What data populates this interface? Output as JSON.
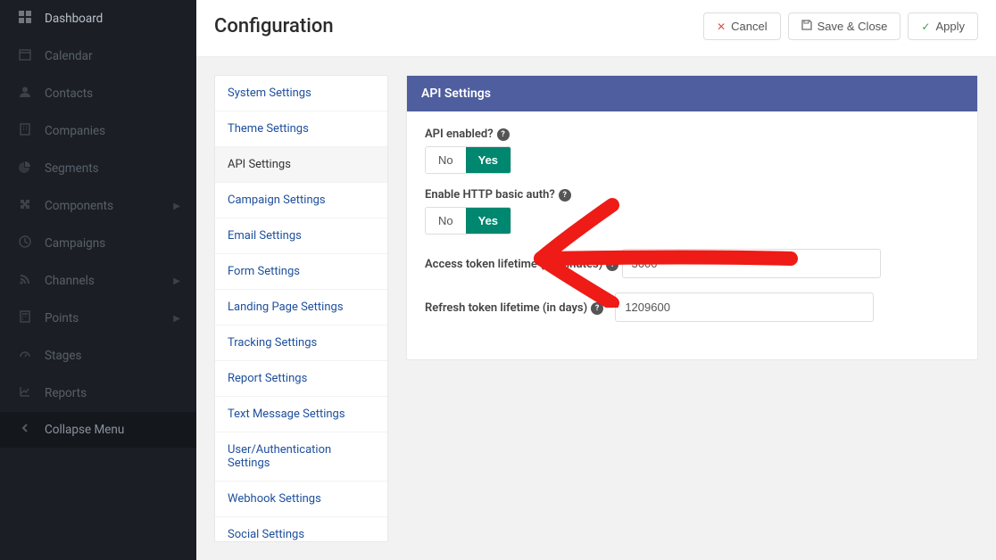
{
  "header": {
    "title": "Configuration",
    "buttons": {
      "cancel": "Cancel",
      "save_close": "Save & Close",
      "apply": "Apply"
    }
  },
  "sidebar": {
    "items": [
      {
        "icon": "⊞",
        "label": "Dashboard",
        "chev": false
      },
      {
        "icon": "🗓",
        "label": "Calendar",
        "chev": false
      },
      {
        "icon": "👤",
        "label": "Contacts",
        "chev": false
      },
      {
        "icon": "🏢",
        "label": "Companies",
        "chev": false
      },
      {
        "icon": "◔",
        "label": "Segments",
        "chev": false
      },
      {
        "icon": "⊕",
        "label": "Components",
        "chev": true
      },
      {
        "icon": "◷",
        "label": "Campaigns",
        "chev": false
      },
      {
        "icon": "≋",
        "label": "Channels",
        "chev": true
      },
      {
        "icon": "▤",
        "label": "Points",
        "chev": true
      },
      {
        "icon": "⊕",
        "label": "Stages",
        "chev": false
      },
      {
        "icon": "📈",
        "label": "Reports",
        "chev": false
      }
    ],
    "collapse": "Collapse Menu"
  },
  "submenu": {
    "items": [
      "System Settings",
      "Theme Settings",
      "API Settings",
      "Campaign Settings",
      "Email Settings",
      "Form Settings",
      "Landing Page Settings",
      "Tracking Settings",
      "Report Settings",
      "Text Message Settings",
      "User/Authentication Settings",
      "Webhook Settings",
      "Social Settings"
    ],
    "active_index": 2
  },
  "panel": {
    "title": "API Settings",
    "fields": {
      "api_enabled": {
        "label": "API enabled?",
        "no": "No",
        "yes": "Yes",
        "value": "Yes"
      },
      "basic_auth": {
        "label": "Enable HTTP basic auth?",
        "no": "No",
        "yes": "Yes",
        "value": "Yes"
      },
      "access_token": {
        "label": "Access token lifetime (in minutes)",
        "value": "3600"
      },
      "refresh_token": {
        "label": "Refresh token lifetime (in days)",
        "value": "1209600",
        "required": true
      }
    }
  }
}
